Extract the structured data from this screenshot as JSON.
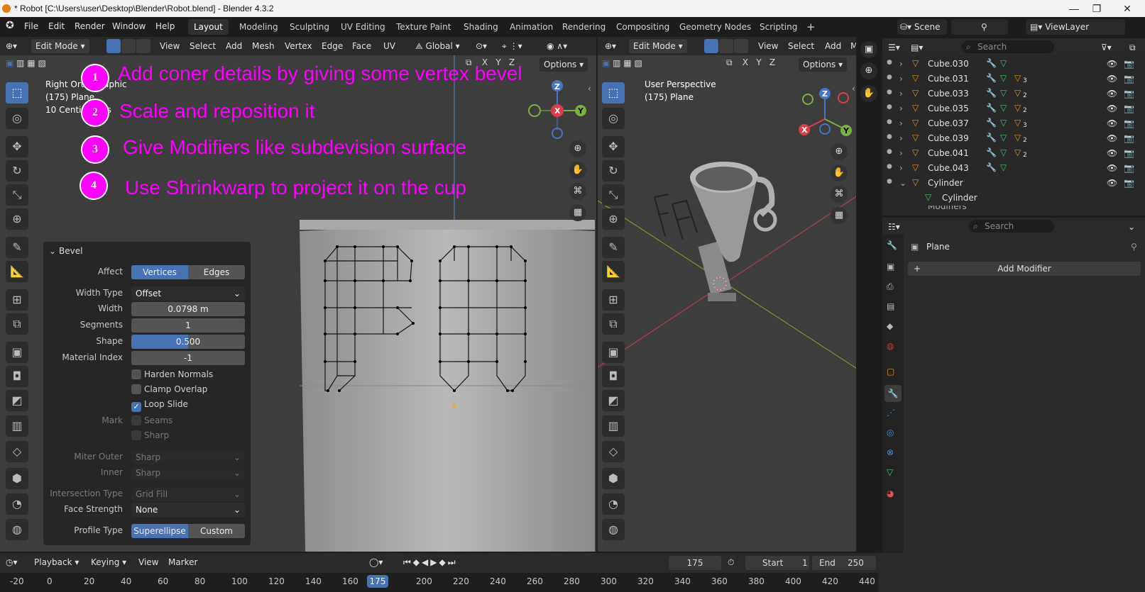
{
  "window": {
    "title": "* Robot [C:\\Users\\user\\Desktop\\Blender\\Robot.blend] - Blender 4.3.2",
    "minimize": "—",
    "maximize": "❐",
    "close": "✕"
  },
  "menus": [
    "File",
    "Edit",
    "Render",
    "Window",
    "Help"
  ],
  "workspaces": [
    "Layout",
    "Modeling",
    "Sculpting",
    "UV Editing",
    "Texture Paint",
    "Shading",
    "Animation",
    "Rendering",
    "Compositing",
    "Geometry Nodes",
    "Scripting"
  ],
  "workspace_add": "+",
  "scene": {
    "name": "Scene",
    "view_layer": "ViewLayer"
  },
  "left_viewport": {
    "mode": "Edit Mode",
    "menus": [
      "View",
      "Select",
      "Add",
      "Mesh",
      "Vertex",
      "Edge",
      "Face",
      "UV"
    ],
    "transform": "Global",
    "axes": [
      "X",
      "Y",
      "Z"
    ],
    "options": "Options",
    "info": [
      "Right Orthographic",
      "(175) Plane",
      "10 Centimeters"
    ]
  },
  "right_viewport": {
    "mode": "Edit Mode",
    "menus": [
      "View",
      "Select",
      "Add",
      "M"
    ],
    "axes": [
      "X",
      "Y",
      "Z"
    ],
    "options": "Options",
    "info": [
      "User Perspective",
      "(175) Plane"
    ]
  },
  "gizmo": {
    "x": "X",
    "y": "Y",
    "z": "Z"
  },
  "steps": [
    {
      "n": "1",
      "text": "Add coner details by giving some vertex bevel"
    },
    {
      "n": "2",
      "text": "Scale and reposition it"
    },
    {
      "n": "3",
      "text": "Give Modifiers like subdevision surface"
    },
    {
      "n": "4",
      "text": "Use Shrinkwarp to project it on the cup"
    }
  ],
  "bevel": {
    "title": "Bevel",
    "affect_label": "Affect",
    "affect_options": [
      "Vertices",
      "Edges"
    ],
    "width_type_label": "Width Type",
    "width_type": "Offset",
    "width_label": "Width",
    "width": "0.0798 m",
    "segments_label": "Segments",
    "segments": "1",
    "shape_label": "Shape",
    "shape": "0.500",
    "shape_fraction": 0.5,
    "material_label": "Material Index",
    "material": "-1",
    "harden": "Harden Normals",
    "clamp": "Clamp Overlap",
    "loop": "Loop Slide",
    "mark_label": "Mark",
    "seams": "Seams",
    "sharp": "Sharp",
    "miter_outer_label": "Miter Outer",
    "miter_outer": "Sharp",
    "inner_label": "Inner",
    "inner": "Sharp",
    "intersection_label": "Intersection Type",
    "intersection": "Grid Fill",
    "face_strength_label": "Face Strength",
    "face_strength": "None",
    "profile_label": "Profile Type",
    "profile_options": [
      "Superellipse",
      "Custom"
    ]
  },
  "outliner": {
    "search_placeholder": "Search",
    "rows": [
      {
        "name": "Cube.030",
        "badge": ""
      },
      {
        "name": "Cube.031",
        "badge": "3"
      },
      {
        "name": "Cube.033",
        "badge": "2"
      },
      {
        "name": "Cube.035",
        "badge": "2"
      },
      {
        "name": "Cube.037",
        "badge": "3"
      },
      {
        "name": "Cube.039",
        "badge": "2"
      },
      {
        "name": "Cube.041",
        "badge": "2"
      },
      {
        "name": "Cube.043",
        "badge": ""
      },
      {
        "name": "Cylinder",
        "badge": ""
      }
    ],
    "child": "Cylinder",
    "partial": "Modifiers"
  },
  "properties": {
    "search_placeholder": "Search",
    "object": "Plane",
    "add_modifier": "Add Modifier"
  },
  "timeline": {
    "menus": [
      "Playback",
      "Keying",
      "View",
      "Marker"
    ],
    "current": "175",
    "start_label": "Start",
    "start": "1",
    "end_label": "End",
    "end": "250",
    "ticks": [
      "-20",
      "0",
      "20",
      "40",
      "60",
      "80",
      "100",
      "120",
      "140",
      "160",
      "",
      "200",
      "220",
      "240",
      "260",
      "280",
      "300",
      "320",
      "340",
      "360",
      "380",
      "400",
      "420",
      "440"
    ],
    "playhead": "175"
  }
}
